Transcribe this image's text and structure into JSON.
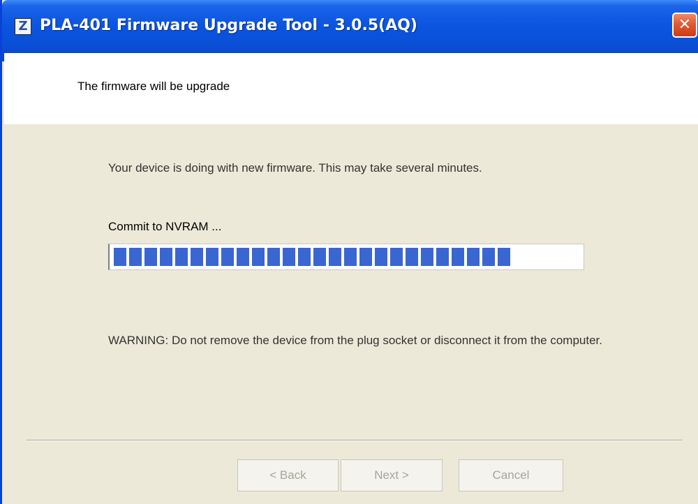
{
  "window": {
    "title": "PLA-401 Firmware Upgrade Tool - 3.0.5(AQ)",
    "app_icon_letter": "Z",
    "close_glyph": "✕"
  },
  "header": {
    "text": "The firmware will be upgrade"
  },
  "main": {
    "message": "Your device is doing with new firmware. This may take several minutes.",
    "step_label": "Commit to NVRAM ...",
    "progress_percent": 85,
    "warning": "WARNING: Do not remove the device from the plug socket or disconnect it from the computer."
  },
  "buttons": {
    "back_label": "< Back",
    "next_label": "Next >",
    "cancel_label": "Cancel"
  },
  "colors": {
    "titlebar": "#0a50d8",
    "progress_block": "#3a66d2",
    "close_button": "#e05a34",
    "dialog_bg": "#ece9d8"
  },
  "icons": {
    "app": "app-logo-icon",
    "close": "close-icon"
  }
}
